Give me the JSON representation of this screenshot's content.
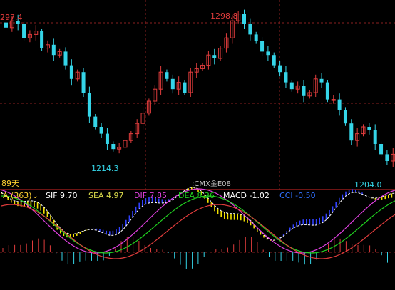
{
  "colors": {
    "background": "#000000",
    "up": "#e03c3c",
    "down": "#35d5e8",
    "grid": "#8a1f1f",
    "sif": "#ffffff",
    "sea": "#d8d84a",
    "dif": "#e040e0",
    "dea": "#20d020",
    "macd": "#ffffff",
    "cci": "#3070ff",
    "fill_box": "#f0e000",
    "fill_bar": "#3040ff"
  },
  "price_labels": {
    "left_high": "297.4",
    "top_high": "1298.8",
    "left_low": "1214.3",
    "right_low": "1204.0"
  },
  "period_label": "89天",
  "instrument_label": ":CMX金E08",
  "indicator_bar": {
    "selector": "A (363)",
    "selector_icon": "chevron-down-icon",
    "sif": "SIF 9.70",
    "sea": "SEA 4.97",
    "dif": "DIF 7.85",
    "dea": "DEA 8.36",
    "macd": "MACD -1.02",
    "cci": "CCI -0.50"
  },
  "chart_data": {
    "type": "candlestick",
    "visible_prices": {
      "high": 1298.8,
      "low": 1204.0,
      "left_edge_value": "297.4"
    },
    "low_points": [
      1214.3,
      1204.0
    ],
    "indicators": {
      "SIF": 9.7,
      "SEA": 4.97,
      "DIF": 7.85,
      "DEA": 8.36,
      "MACD": -1.02,
      "CCI": -0.5
    }
  }
}
